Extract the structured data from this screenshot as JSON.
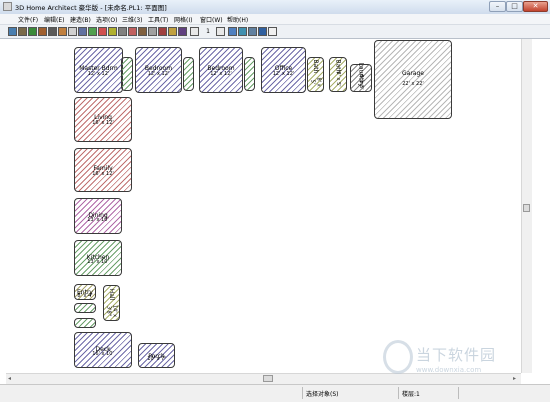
{
  "window": {
    "title": "3D Home Architect 豪华版 - [未命名.PL1: 平面图]"
  },
  "menu": [
    "文件(F)",
    "编辑(E)",
    "建造(B)",
    "选项(O)",
    "三维(3)",
    "工具(T)",
    "网格(I)",
    "窗口(W)",
    "帮助(H)"
  ],
  "toolbar": {
    "floor_number": "1"
  },
  "rooms": [
    {
      "name": "Master Bdrm",
      "dims": "12' x 12'",
      "color": "#6e6aa8"
    },
    {
      "name": "Bedroom",
      "dims": "12' x 12'",
      "color": "#6e6aa8"
    },
    {
      "name": "Bedroom",
      "dims": "12' x 12'",
      "color": "#6e6aa8"
    },
    {
      "name": "Office",
      "dims": "12' x 12'",
      "color": "#6e6aa8"
    },
    {
      "name": "Bath",
      "dims": "8' x 5'",
      "color": "#a9b06a"
    },
    {
      "name": "Bath",
      "dims": "8' x 5'",
      "color": "#a9b06a"
    },
    {
      "name": "Laundry",
      "dims": "8' x 5'",
      "color": "#888888"
    },
    {
      "name": "Garage",
      "dims": "22' x 22'",
      "color": "#b8b8b8"
    },
    {
      "name": "Living",
      "dims": "16' x 12'",
      "color": "#c07070"
    },
    {
      "name": "Family",
      "dims": "16' x 12'",
      "color": "#c07070"
    },
    {
      "name": "Dining",
      "dims": "13' x 10'",
      "color": "#b06aa8"
    },
    {
      "name": "Kitchen",
      "dims": "13' x 10'",
      "color": "#6aa06a"
    },
    {
      "name": "Entry",
      "dims": "8' x 4'",
      "color": "#a9a56a"
    },
    {
      "name": "Hall",
      "dims": "14' x 3'8\"",
      "color": "#a9b06a"
    },
    {
      "name": "Deck",
      "dims": "16' x 10'",
      "color": "#6e6aa8"
    },
    {
      "name": "Porch",
      "dims": "10' x 7'",
      "color": "#6e6aa8"
    }
  ],
  "status": {
    "selected": "选择对象(S)",
    "floor": "楼层:1"
  },
  "watermark": {
    "text": "当下软件园",
    "url": "www.downxia.com"
  }
}
